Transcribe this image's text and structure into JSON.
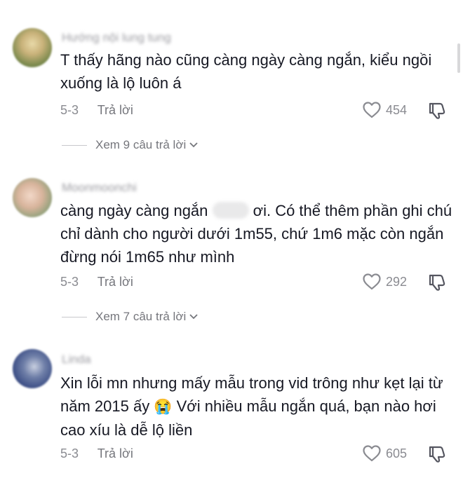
{
  "comments": [
    {
      "username": "Hướng nội lung tung",
      "text": "T thấy hãng nào cũng càng ngày càng ngắn, kiểu ngồi xuống là lộ luôn á",
      "date": "5-3",
      "reply_label": "Trả lời",
      "likes": "454",
      "view_replies": "Xem 9 câu trả lời"
    },
    {
      "username": "Moonmoonchi",
      "text_before": "càng ngày càng ngắn",
      "text_after": "ơi. Có thể thêm phần ghi chú chỉ dành cho người dưới 1m55, chứ 1m6 mặc còn ngắn đừng nói 1m65 như mình",
      "date": "5-3",
      "reply_label": "Trả lời",
      "likes": "292",
      "view_replies": "Xem 7 câu trả lời"
    },
    {
      "username": "Linda",
      "text_before": "Xin lỗi mn nhưng mấy mẫu trong vid trông như kẹt lại từ năm 2015 ấy",
      "emoji": "😭",
      "text_after": "Với nhiều mẫu ngắn quá, bạn nào hơi cao xíu là dễ lộ liền",
      "date": "5-3",
      "reply_label": "Trả lời",
      "likes": "605"
    }
  ],
  "icons": {
    "like": "heart-outline-icon",
    "dislike": "thumbs-down-outline-icon",
    "expand": "chevron-down-icon"
  },
  "colors": {
    "text": "#161823",
    "meta": "#8a8b91",
    "background": "#ffffff"
  }
}
